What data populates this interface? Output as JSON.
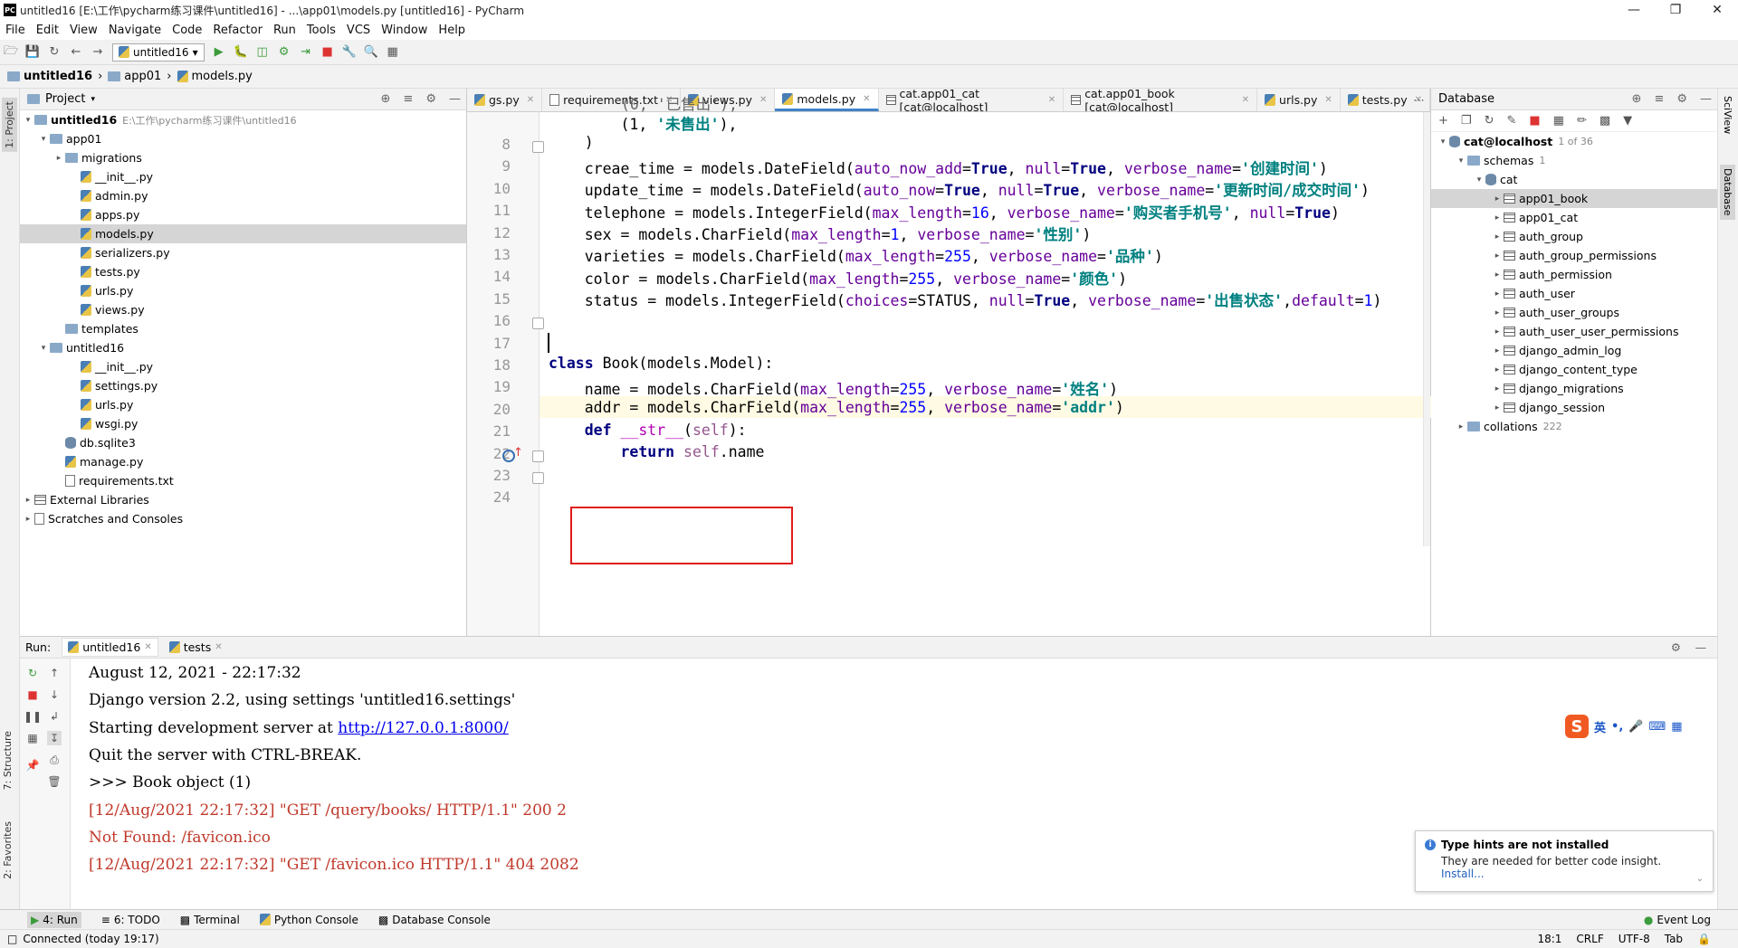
{
  "window": {
    "title": "untitled16 [E:\\工作\\pycharm练习课件\\untitled16] - ...\\app01\\models.py [untitled16] - PyCharm",
    "app_icon_text": "PC"
  },
  "menu": [
    "File",
    "Edit",
    "View",
    "Navigate",
    "Code",
    "Refactor",
    "Run",
    "Tools",
    "VCS",
    "Window",
    "Help"
  ],
  "toolbar": {
    "run_config": "untitled16"
  },
  "breadcrumb": [
    "untitled16",
    "app01",
    "models.py"
  ],
  "project_panel": {
    "title": "Project",
    "tree": [
      {
        "label": "untitled16",
        "hint": "E:\\工作\\pycharm练习课件\\untitled16",
        "indent": 0,
        "arrow": "▾",
        "icon": "folder",
        "bold": true
      },
      {
        "label": "app01",
        "indent": 1,
        "arrow": "▾",
        "icon": "folder"
      },
      {
        "label": "migrations",
        "indent": 2,
        "arrow": "▸",
        "icon": "folder"
      },
      {
        "label": "__init__.py",
        "indent": 3,
        "arrow": "",
        "icon": "py"
      },
      {
        "label": "admin.py",
        "indent": 3,
        "arrow": "",
        "icon": "py"
      },
      {
        "label": "apps.py",
        "indent": 3,
        "arrow": "",
        "icon": "py"
      },
      {
        "label": "models.py",
        "indent": 3,
        "arrow": "",
        "icon": "py",
        "selected": true
      },
      {
        "label": "serializers.py",
        "indent": 3,
        "arrow": "",
        "icon": "py"
      },
      {
        "label": "tests.py",
        "indent": 3,
        "arrow": "",
        "icon": "py"
      },
      {
        "label": "urls.py",
        "indent": 3,
        "arrow": "",
        "icon": "py"
      },
      {
        "label": "views.py",
        "indent": 3,
        "arrow": "",
        "icon": "py"
      },
      {
        "label": "templates",
        "indent": 2,
        "arrow": "",
        "icon": "folder"
      },
      {
        "label": "untitled16",
        "indent": 1,
        "arrow": "▾",
        "icon": "folder"
      },
      {
        "label": "__init__.py",
        "indent": 3,
        "arrow": "",
        "icon": "py"
      },
      {
        "label": "settings.py",
        "indent": 3,
        "arrow": "",
        "icon": "py"
      },
      {
        "label": "urls.py",
        "indent": 3,
        "arrow": "",
        "icon": "py"
      },
      {
        "label": "wsgi.py",
        "indent": 3,
        "arrow": "",
        "icon": "py"
      },
      {
        "label": "db.sqlite3",
        "indent": 2,
        "arrow": "",
        "icon": "db"
      },
      {
        "label": "manage.py",
        "indent": 2,
        "arrow": "",
        "icon": "py"
      },
      {
        "label": "requirements.txt",
        "indent": 2,
        "arrow": "",
        "icon": "txt"
      },
      {
        "label": "External Libraries",
        "indent": 0,
        "arrow": "▸",
        "icon": "lib"
      },
      {
        "label": "Scratches and Consoles",
        "indent": 0,
        "arrow": "▸",
        "icon": "scratch"
      }
    ]
  },
  "editor_tabs": [
    {
      "label": "gs.py",
      "icon": "py"
    },
    {
      "label": "requirements.txt",
      "icon": "txt"
    },
    {
      "label": "views.py",
      "icon": "py"
    },
    {
      "label": "models.py",
      "icon": "py",
      "active": true
    },
    {
      "label": "cat.app01_cat [cat@localhost]",
      "icon": "table"
    },
    {
      "label": "cat.app01_book [cat@localhost]",
      "icon": "table"
    },
    {
      "label": "urls.py",
      "icon": "py"
    },
    {
      "label": "tests.py",
      "icon": "py"
    }
  ],
  "code": {
    "line_numbers": [
      "8",
      "9",
      "10",
      "11",
      "12",
      "13",
      "14",
      "15",
      "16",
      "17",
      "18",
      "19",
      "20",
      "21",
      "22",
      "23",
      "24"
    ],
    "partial_top": "(0, '已售出'),",
    "lines": [
      "        (1, '未售出'),",
      "    )",
      "    creae_time = models.DateField(auto_now_add=True, null=True, verbose_name='创建时间')",
      "    update_time = models.DateField(auto_now=True, null=True, verbose_name='更新时间/成交时间')",
      "    telephone = models.IntegerField(max_length=16, verbose_name='购买者手机号', null=True)",
      "    sex = models.CharField(max_length=1, verbose_name='性别')",
      "    varieties = models.CharField(max_length=255, verbose_name='品种')",
      "    color = models.CharField(max_length=255, verbose_name='颜色')",
      "    status = models.IntegerField(choices=STATUS, null=True, verbose_name='出售状态',default=1)",
      "",
      "",
      "class Book(models.Model):",
      "    name = models.CharField(max_length=255, verbose_name='姓名')",
      "    addr = models.CharField(max_length=255, verbose_name='addr')",
      "    def __str__(self):",
      "        return self.name",
      ""
    ]
  },
  "database_panel": {
    "title": "Database",
    "connection": "cat@localhost",
    "connection_hint": "1 of 36",
    "schemas_label": "schemas",
    "schemas_count": "1",
    "schema": "cat",
    "tables": [
      "app01_book",
      "app01_cat",
      "auth_group",
      "auth_group_permissions",
      "auth_permission",
      "auth_user",
      "auth_user_groups",
      "auth_user_user_permissions",
      "django_admin_log",
      "django_content_type",
      "django_migrations",
      "django_session"
    ],
    "collations_label": "collations",
    "collations_count": "222"
  },
  "run_panel": {
    "label": "Run:",
    "tabs": [
      "untitled16",
      "tests"
    ],
    "output": [
      {
        "text": "August 12, 2021 - 22:17:32",
        "red": false
      },
      {
        "text": "Django version 2.2, using settings 'untitled16.settings'",
        "red": false
      },
      {
        "text": "Starting development server at ",
        "link": "http://127.0.0.1:8000/",
        "red": false
      },
      {
        "text": "Quit the server with CTRL-BREAK.",
        "red": false
      },
      {
        "text": ">>> Book object (1)",
        "red": false
      },
      {
        "text": "[12/Aug/2021 22:17:32] \"GET /query/books/ HTTP/1.1\" 200 2",
        "red": true
      },
      {
        "text": "Not Found: /favicon.ico",
        "red": true
      },
      {
        "text": "[12/Aug/2021 22:17:32] \"GET /favicon.ico HTTP/1.1\" 404 2082",
        "red": true
      }
    ]
  },
  "notification": {
    "title": "Type hints are not installed",
    "body": "They are needed for better code insight.",
    "link": "Install..."
  },
  "ime": {
    "logo": "S",
    "lang": "英",
    "punct": "•,"
  },
  "left_strip_tabs": [
    "1: Project",
    "7: Structure",
    "2: Favorites"
  ],
  "right_strip_tabs": [
    "SciView",
    "Database"
  ],
  "bottom_tabs": [
    "4: Run",
    "6: TODO",
    "Terminal",
    "Python Console",
    "Database Console"
  ],
  "event_log": "Event Log",
  "status": {
    "left": "Connected (today 19:17)",
    "position": "18:1",
    "line_sep": "CRLF",
    "encoding": "UTF-8",
    "indent": "Tab"
  }
}
